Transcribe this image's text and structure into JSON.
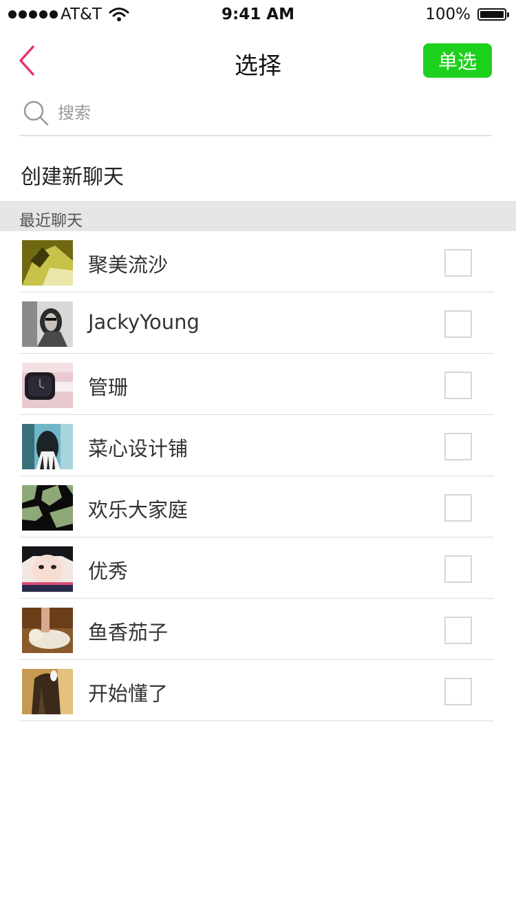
{
  "status_bar": {
    "carrier": "AT&T",
    "time": "9:41 AM",
    "battery": "100%",
    "signal_icon": "signal-dots-icon",
    "wifi_icon": "wifi-icon",
    "battery_icon": "battery-icon"
  },
  "nav": {
    "back_icon": "chevron-left-icon",
    "title": "选择",
    "mode_button": "单选",
    "accent_color": "#e8326a",
    "button_color": "#1ed01e"
  },
  "search": {
    "placeholder": "搜索",
    "value": "",
    "icon": "search-icon"
  },
  "create_chat": {
    "label": "创建新聊天"
  },
  "recent_section": {
    "title": "最近聊天"
  },
  "contacts": [
    {
      "name": "聚美流沙",
      "checked": false,
      "avatar": "photo-avatar"
    },
    {
      "name": "JackyYoung",
      "checked": false,
      "avatar": "photo-avatar"
    },
    {
      "name": "管珊",
      "checked": false,
      "avatar": "photo-avatar"
    },
    {
      "name": "菜心设计铺",
      "checked": false,
      "avatar": "photo-avatar"
    },
    {
      "name": "欢乐大家庭",
      "checked": false,
      "avatar": "photo-avatar"
    },
    {
      "name": "优秀",
      "checked": false,
      "avatar": "photo-avatar"
    },
    {
      "name": "鱼香茄子",
      "checked": false,
      "avatar": "photo-avatar"
    },
    {
      "name": "开始懂了",
      "checked": false,
      "avatar": "photo-avatar"
    }
  ]
}
